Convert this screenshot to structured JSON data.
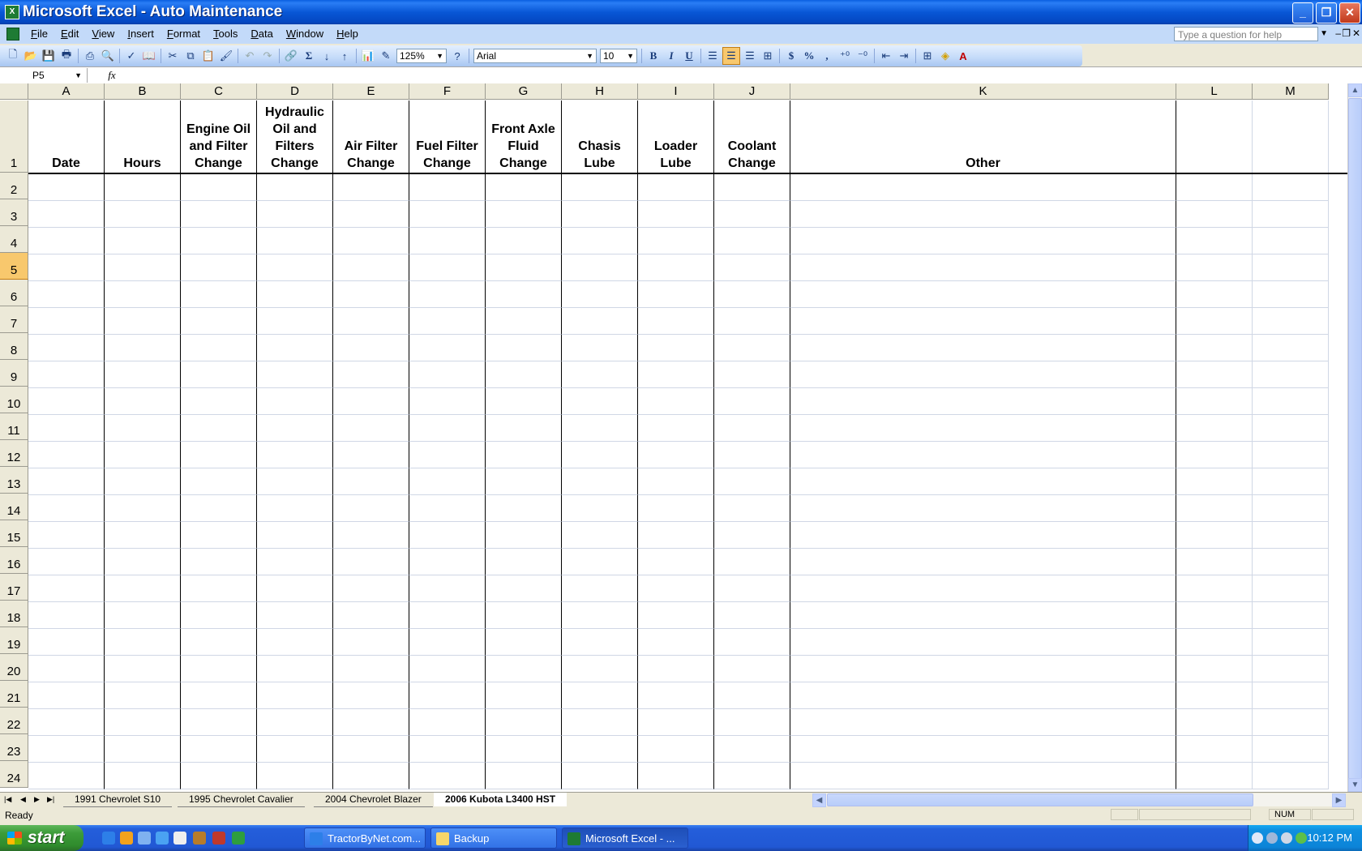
{
  "window": {
    "title": "Microsoft Excel - Auto Maintenance"
  },
  "menu": {
    "items": [
      "File",
      "Edit",
      "View",
      "Insert",
      "Format",
      "Tools",
      "Data",
      "Window",
      "Help"
    ],
    "help_placeholder": "Type a question for help"
  },
  "toolbar": {
    "zoom": "125%",
    "font_name": "Arial",
    "font_size": "10",
    "bold_label": "B",
    "italic_label": "I",
    "underline_label": "U",
    "currency_label": "$",
    "percent_label": "%",
    "comma_label": ",",
    "sum_label": "Σ"
  },
  "formula_bar": {
    "name_box": "P5",
    "fx_label": "fx",
    "formula": ""
  },
  "sheet": {
    "columns": [
      "A",
      "B",
      "C",
      "D",
      "E",
      "F",
      "G",
      "H",
      "I",
      "J",
      "K",
      "L",
      "M"
    ],
    "rows": [
      "1",
      "2",
      "3",
      "4",
      "5",
      "6",
      "7",
      "8",
      "9",
      "10",
      "11",
      "12",
      "13",
      "14",
      "15",
      "16",
      "17",
      "18",
      "19",
      "20",
      "21",
      "22",
      "23",
      "24"
    ],
    "active_row": "5",
    "headers": [
      "Date",
      "Hours",
      "Engine Oil and Filter Change",
      "Hydraulic Oil and Filters Change",
      "Air Filter Change",
      "Fuel Filter Change",
      "Front Axle Fluid Change",
      "Chasis Lube",
      "Loader Lube",
      "Coolant Change",
      "Other",
      "",
      ""
    ]
  },
  "sheet_tabs": {
    "tabs": [
      "1991 Chevrolet S10",
      "1995 Chevrolet Cavalier",
      "2004 Chevrolet Blazer",
      "2006 Kubota L3400 HST"
    ],
    "active": "2006 Kubota L3400 HST"
  },
  "status": {
    "text": "Ready",
    "num": "NUM"
  },
  "taskbar": {
    "start_label": "start",
    "buttons": [
      "TractorByNet.com...",
      "Backup",
      "Microsoft Excel - ..."
    ],
    "clock": "10:12 PM"
  },
  "colors": {
    "title_bar": "#0857d6",
    "menu_bar": "#c3daf9",
    "active_header": "#f8c86d",
    "taskbar": "#245edb",
    "start_button": "#3d9c3a"
  }
}
